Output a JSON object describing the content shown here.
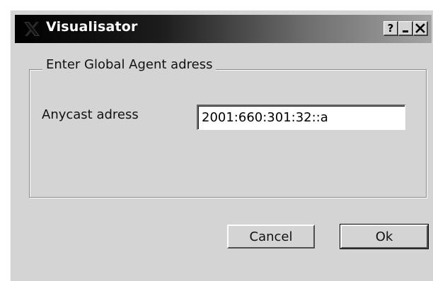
{
  "window": {
    "title": "Visualisator",
    "title_buttons": {
      "help": "?",
      "minimize": "_",
      "close": "X"
    }
  },
  "group": {
    "title": "Enter Global Agent adress"
  },
  "anycast": {
    "label": "Anycast adress",
    "value": "2001:660:301:32::a"
  },
  "buttons": {
    "cancel": "Cancel",
    "ok": "Ok"
  },
  "icons": {
    "app": "x-logo-icon",
    "help": "question-mark-icon",
    "minimize": "minimize-icon",
    "close": "close-icon"
  },
  "colors": {
    "window_bg": "#d4d4d4",
    "titlebar_start": "#000000",
    "titlebar_end": "#a4a4a4",
    "title_text": "#ffffff"
  }
}
